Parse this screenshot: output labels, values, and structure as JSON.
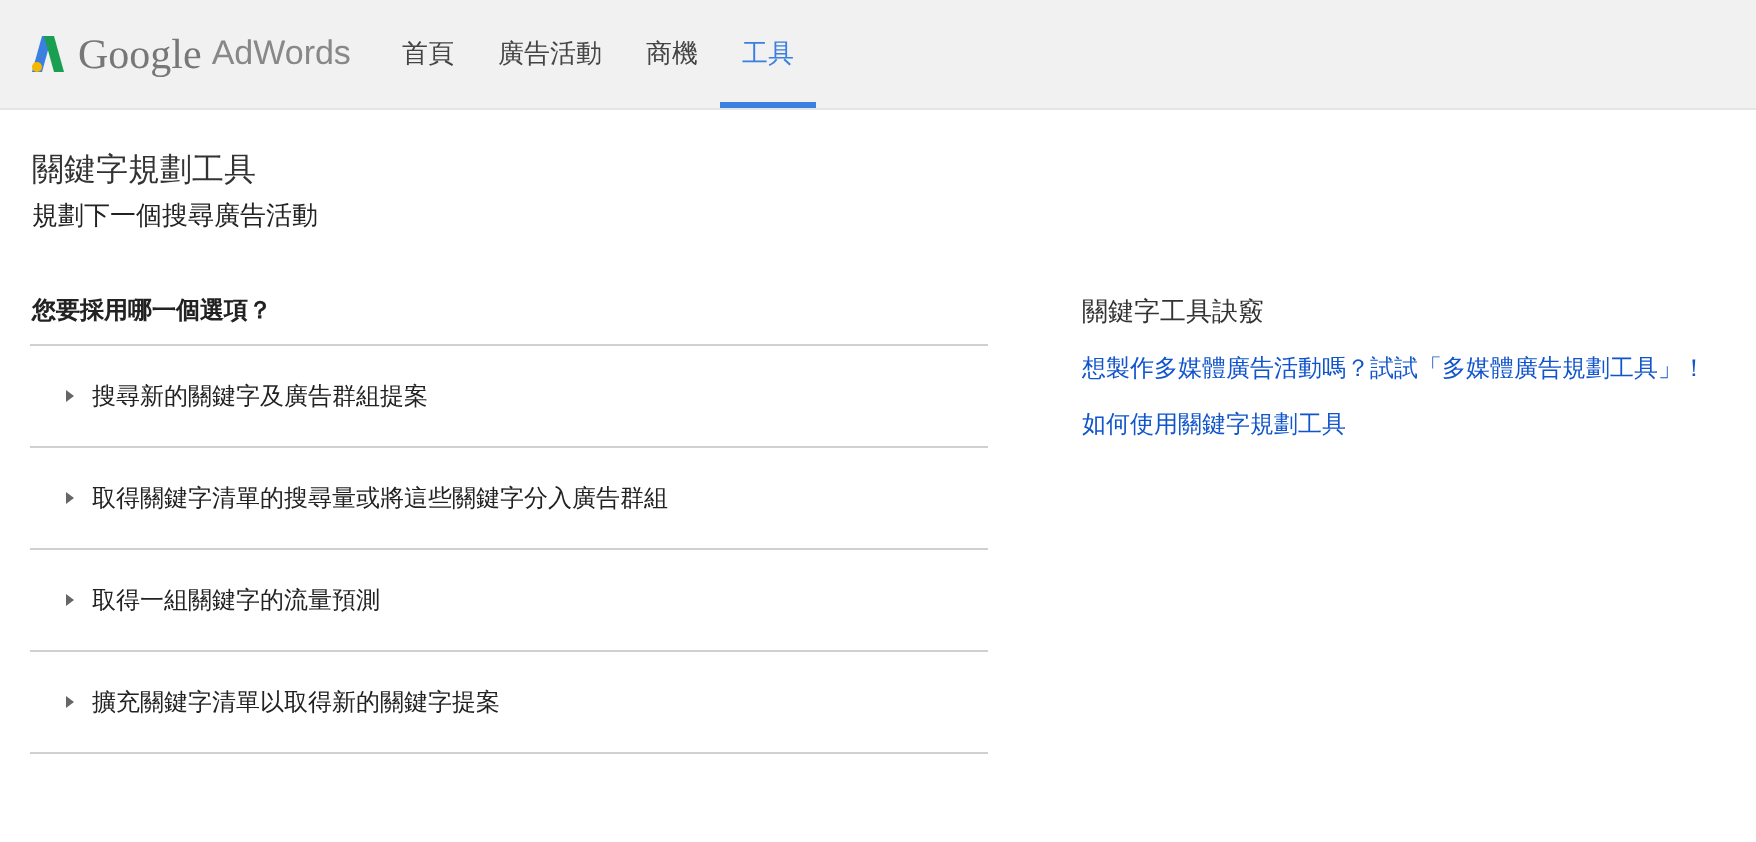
{
  "header": {
    "logo_google": "Google",
    "logo_product": "AdWords",
    "nav": [
      {
        "label": "首頁",
        "selected": false
      },
      {
        "label": "廣告活動",
        "selected": false
      },
      {
        "label": "商機",
        "selected": false
      },
      {
        "label": "工具",
        "selected": true
      }
    ]
  },
  "page": {
    "title": "關鍵字規劃工具",
    "subtitle": "規劃下一個搜尋廣告活動"
  },
  "options": {
    "heading": "您要採用哪一個選項？",
    "items": [
      {
        "label": "搜尋新的關鍵字及廣告群組提案",
        "expanded": false
      },
      {
        "label": "取得關鍵字清單的搜尋量或將這些關鍵字分入廣告群組",
        "expanded": false
      },
      {
        "label": "取得一組關鍵字的流量預測",
        "expanded": false
      },
      {
        "label": "擴充關鍵字清單以取得新的關鍵字提案",
        "expanded": false
      }
    ]
  },
  "tips": {
    "title": "關鍵字工具訣竅",
    "links": [
      "想製作多媒體廣告活動嗎？試試「多媒體廣告規劃工具」！",
      "如何使用關鍵字規劃工具"
    ]
  }
}
